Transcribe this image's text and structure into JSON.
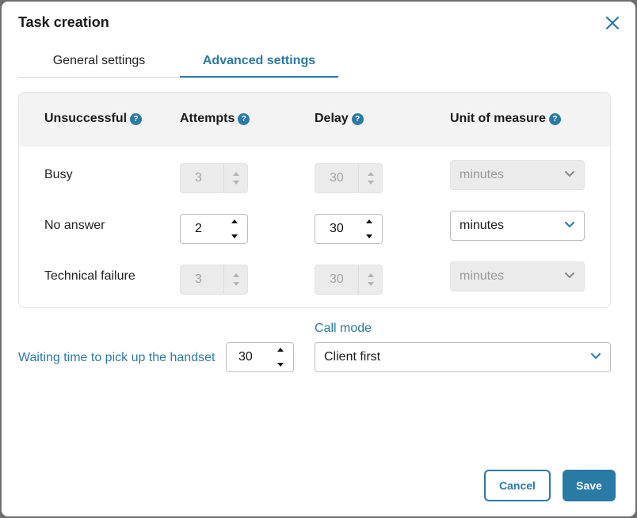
{
  "dialog": {
    "title": "Task creation"
  },
  "tabs": [
    {
      "label": "General settings",
      "active": false
    },
    {
      "label": "Advanced settings",
      "active": true
    }
  ],
  "table": {
    "headers": {
      "unsuccessful": "Unsuccessful",
      "attempts": "Attempts",
      "delay": "Delay",
      "unit": "Unit of measure"
    },
    "help_glyph": "?",
    "rows": [
      {
        "label": "Busy",
        "attempts": "3",
        "delay": "30",
        "unit": "minutes",
        "enabled": false
      },
      {
        "label": "No answer",
        "attempts": "2",
        "delay": "30",
        "unit": "minutes",
        "enabled": true
      },
      {
        "label": "Technical failure",
        "attempts": "3",
        "delay": "30",
        "unit": "minutes",
        "enabled": false
      }
    ]
  },
  "waiting": {
    "label": "Waiting time to pick up the handset",
    "value": "30"
  },
  "call_mode": {
    "label": "Call mode",
    "value": "Client first"
  },
  "actions": {
    "cancel": "Cancel",
    "save": "Save"
  },
  "colors": {
    "accent": "#2a7aa6",
    "disabled_bg": "#ebebeb",
    "header_bg": "#f3f3f3"
  },
  "icons": {
    "close": "close-icon",
    "help": "help-icon",
    "chevron": "chevron-down-icon",
    "step_up": "caret-up-icon",
    "step_down": "caret-down-icon"
  }
}
